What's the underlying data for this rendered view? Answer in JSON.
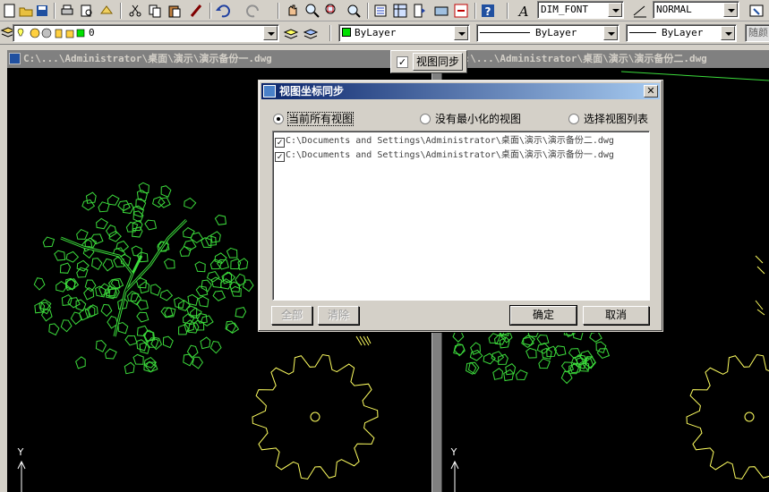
{
  "toolbar": {
    "text_style": "DIM_FONT",
    "dim_style": "NORMAL",
    "layer_name": "0",
    "color": "ByLayer",
    "linetype": "ByLayer",
    "lineweight": "ByLayer",
    "plot_style": "随颜"
  },
  "panes": {
    "left_title": "C:\\...\\Administrator\\桌面\\演示\\演示备份一.dwg",
    "right_title": "C:\\...\\Administrator\\桌面\\演示\\演示备份二.dwg",
    "left_axis": "Y",
    "right_axis": "Y"
  },
  "floatbar": {
    "checkbox_mark": "✓",
    "button_label": "视图同步"
  },
  "dialog": {
    "title": "视图坐标同步",
    "close_label": "✕",
    "radio_all": "当前所有视图",
    "radio_not_min": "没有最小化的视图",
    "radio_select": "选择视图列表",
    "files": [
      "C:\\Documents and Settings\\Administrator\\桌面\\演示\\演示备份二.dwg",
      "C:\\Documents and Settings\\Administrator\\桌面\\演示\\演示备份一.dwg"
    ],
    "check_mark": "✓",
    "btn_all": "全部",
    "btn_clear": "清除",
    "btn_ok": "确定",
    "btn_cancel": "取消"
  },
  "colors": {
    "tree_green": "#3cdc3c",
    "gear_yellow": "#ffff60",
    "title_blue": "#0a246a"
  }
}
